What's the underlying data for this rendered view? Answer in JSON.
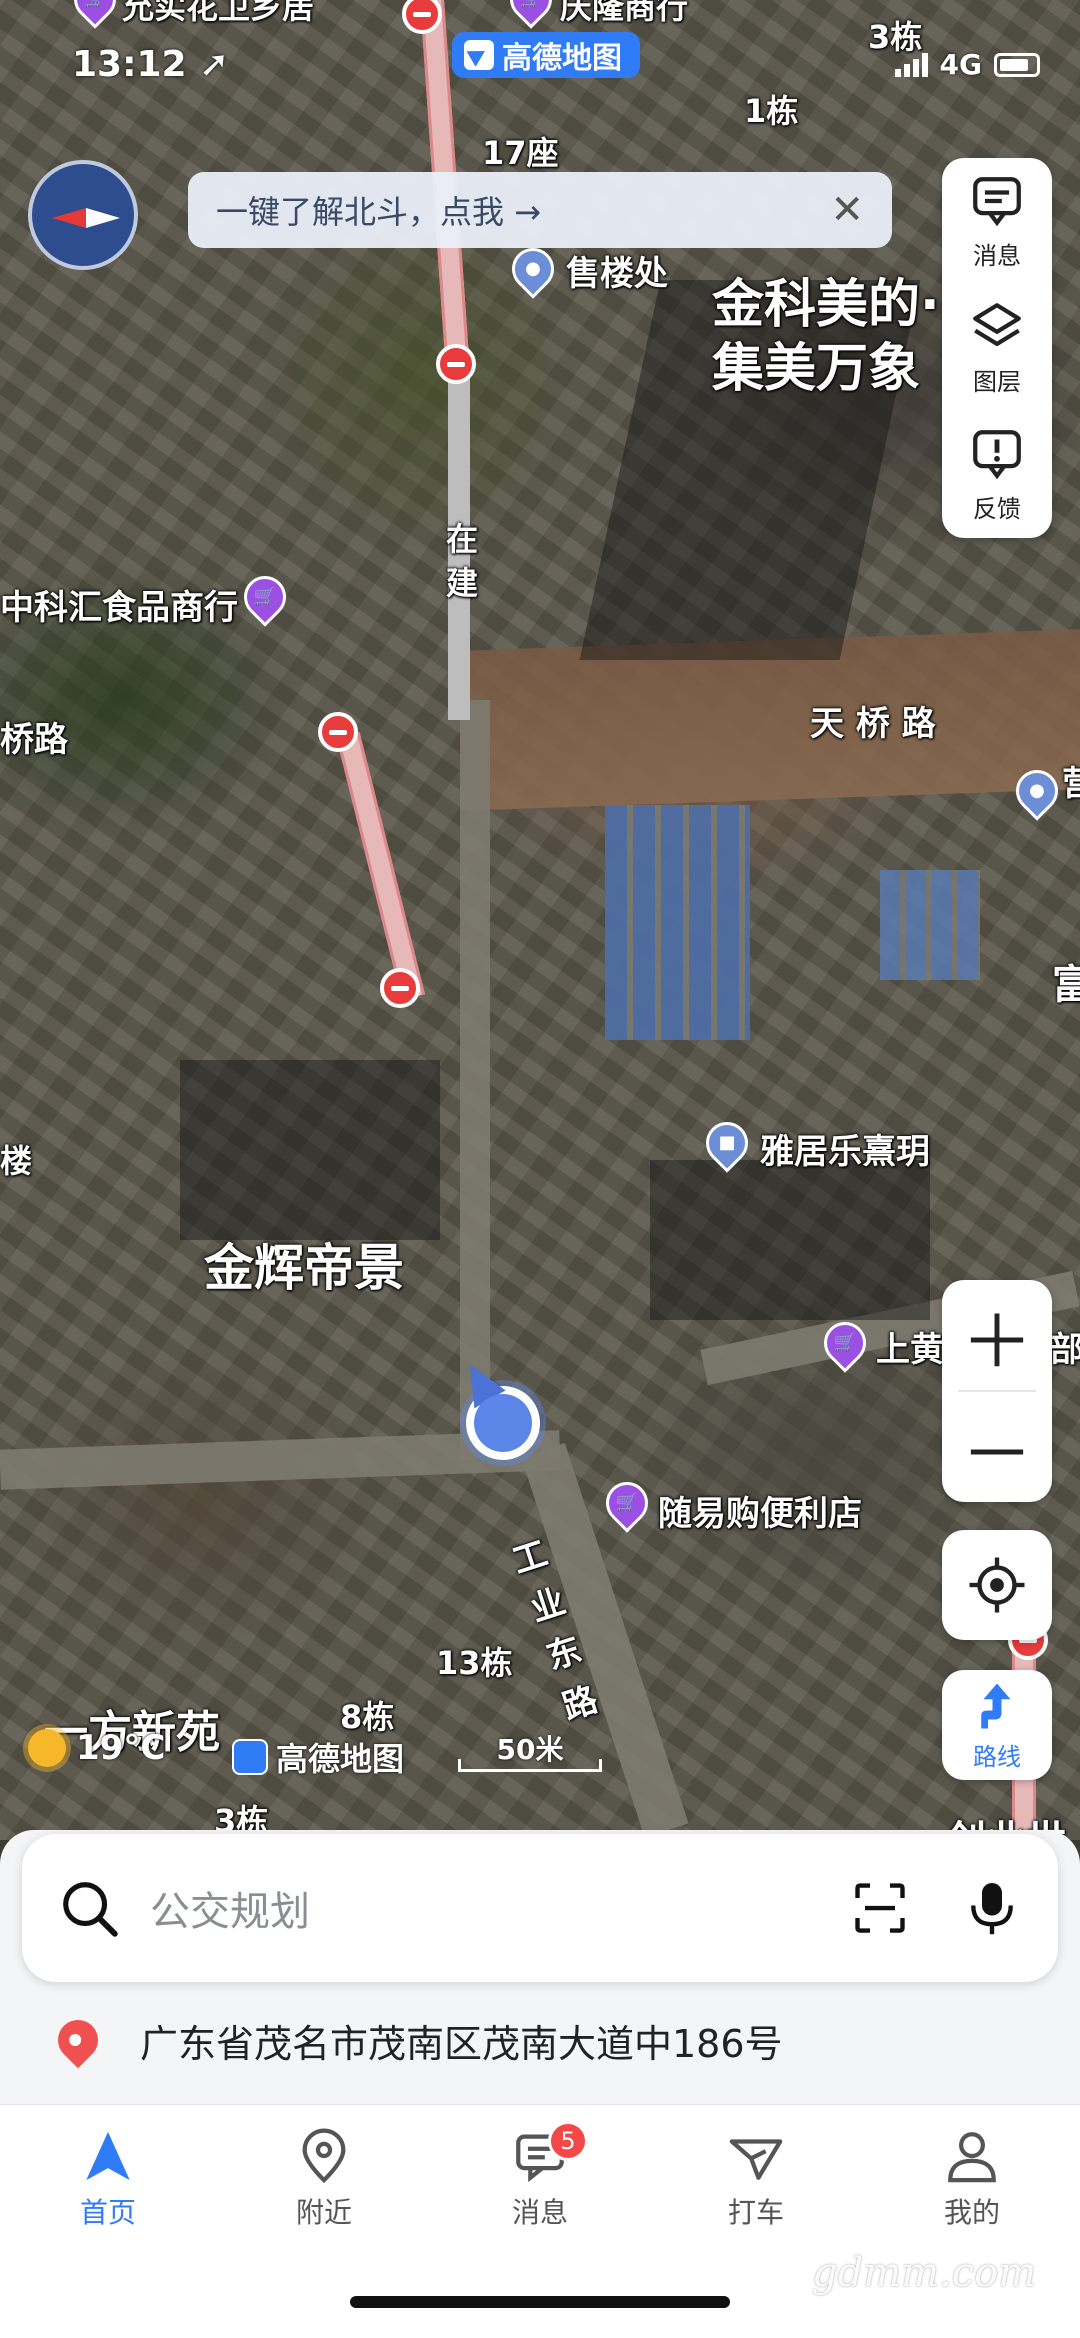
{
  "status_bar": {
    "time": "13:12",
    "carrier_tech": "4G"
  },
  "amap_brand": "高德地图",
  "banner": {
    "text": "一键了解北斗，点我 →",
    "close": "✕"
  },
  "side_panel": [
    {
      "label": "消息",
      "icon": "message-icon"
    },
    {
      "label": "图层",
      "icon": "layers-icon"
    },
    {
      "label": "反馈",
      "icon": "feedback-icon"
    }
  ],
  "map_labels": {
    "top_poi1": "允实花卫乡居",
    "top_poi2": "庆隆商行",
    "bldg_3": "3栋",
    "bldg_1": "1栋",
    "bldg_17": "17座",
    "sales_office": "售楼处",
    "jinke_line1": "金科美的·",
    "jinke_line2": "集美万象",
    "under_construction_1": "在",
    "under_construction_2": "建",
    "food_shop": "中科汇食品商行",
    "qiao_road": "桥路",
    "tianqiao_road": "天 桥 路",
    "right_edge_1": "富",
    "right_edge_2": "营",
    "lou": "楼",
    "yajuyue": "雅居乐熹玥",
    "jinhui": "金辉帝景",
    "shanghuang": "上黄",
    "bu": "部",
    "convenience": "随易购便利店",
    "gongye_1": "工",
    "gongye_2": "业",
    "gongye_3": "东",
    "gongye_4": "路",
    "bldg_13": "13栋",
    "bldg_8": "8栋",
    "yifang": "一方新苑",
    "bldg_3b": "3栋",
    "chuang": "创业世"
  },
  "weather": {
    "temp": "19°C"
  },
  "scale": {
    "label": "50米"
  },
  "search": {
    "placeholder": "公交规划"
  },
  "address": "广东省茂名市茂南区茂南大道中186号",
  "route_button": "路线",
  "tabs": [
    {
      "label": "首页",
      "icon": "home-nav-icon",
      "active": true
    },
    {
      "label": "附近",
      "icon": "nearby-pin-icon"
    },
    {
      "label": "消息",
      "icon": "message-tab-icon",
      "badge": "5"
    },
    {
      "label": "打车",
      "icon": "taxi-icon"
    },
    {
      "label": "我的",
      "icon": "profile-icon"
    }
  ],
  "watermark": "gdmm.com",
  "colors": {
    "accent": "#2f7cf6",
    "badge": "#f44848",
    "poi_purple": "#9b4fe3"
  }
}
